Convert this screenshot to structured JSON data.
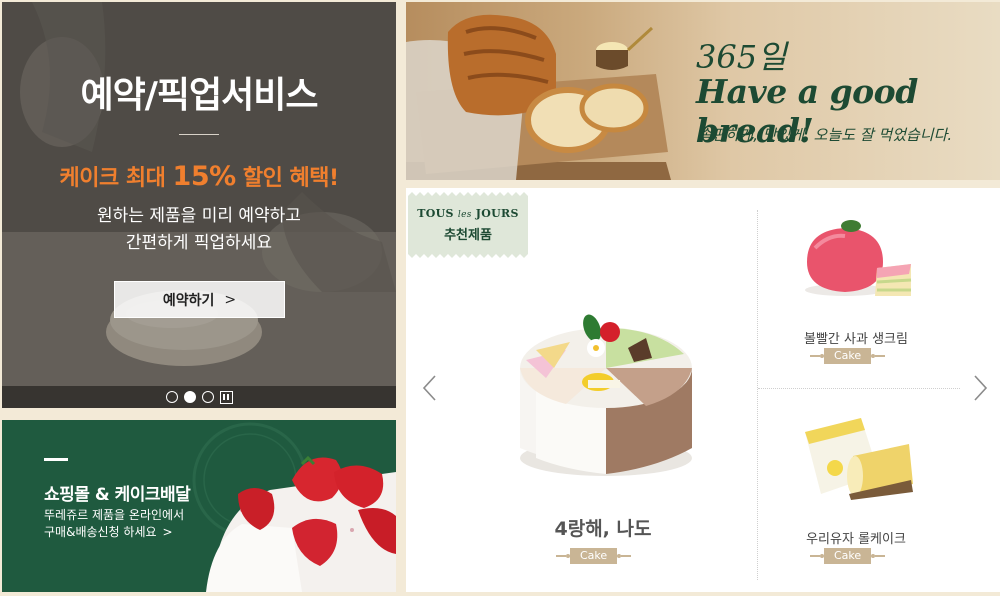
{
  "hero": {
    "title": "예약/픽업서비스",
    "promo_prefix": "케이크 최대 ",
    "promo_big": "15%",
    "promo_suffix": " 할인 혜택!",
    "desc_line1": "원하는 제품을 미리 예약하고",
    "desc_line2": "간편하게 픽업하세요",
    "button_label": "예약하기",
    "button_chevron": ">",
    "pager": {
      "count": 3,
      "active_index": 1
    }
  },
  "mall_banner": {
    "title": "쇼핑몰 & 케이크배달",
    "desc_line1": "뚜레쥬르 제품을 온라인에서",
    "desc_line2": "구매&배송신청 하세요",
    "chevron": ">"
  },
  "bread_banner": {
    "line1": "365일",
    "line2": "Have a good bread!",
    "line3": "속편하게, 맛있게, 오늘도 잘 먹었습니다."
  },
  "recommend": {
    "badge_brand_1": "TOUS ",
    "badge_brand_2": "les",
    "badge_brand_3": " JOURS",
    "badge_label": "추천제품",
    "main_product": {
      "name": "4랑해, 나도",
      "tag": "Cake"
    },
    "side_products": [
      {
        "name": "볼빨간 사과 생크림",
        "tag": "Cake"
      },
      {
        "name": "우리유자 롤케이크",
        "tag": "Cake"
      }
    ]
  },
  "colors": {
    "accent_orange": "#f07f2e",
    "brand_green": "#1f5a3f",
    "tag_tan": "#c9b595",
    "page_bg": "#f3ead7"
  },
  "icons": [
    "chevron-left-icon",
    "chevron-right-icon",
    "pause-icon"
  ]
}
